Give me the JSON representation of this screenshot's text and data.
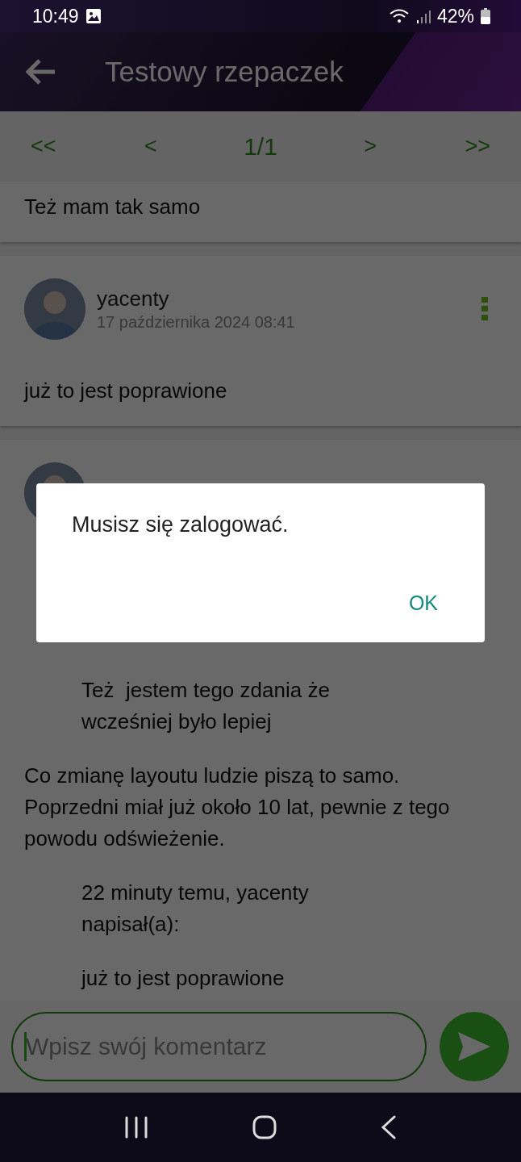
{
  "status_bar": {
    "time": "10:49",
    "battery": "42%"
  },
  "app_bar": {
    "title": "Testowy rzepaczek"
  },
  "pager": {
    "first": "<<",
    "prev": "<",
    "page": "1/1",
    "next": ">",
    "last": ">>"
  },
  "comments": [
    {
      "header": false,
      "blocks": [
        {
          "kind": "text",
          "text": "Też mam tak samo"
        }
      ]
    },
    {
      "header": true,
      "author": "yacenty",
      "date": "17 października 2024 08:41",
      "blocks": [
        {
          "kind": "text",
          "text": "już to jest poprawione"
        }
      ]
    },
    {
      "header": true,
      "blocks": [
        {
          "kind": "quote",
          "text": "Też  jestem tego zdania że wcześniej było lepiej"
        },
        {
          "kind": "text",
          "text": "Co zmianę layoutu ludzie piszą to samo. Poprzedni miał już około 10 lat, pewnie z tego powodu odświeżenie."
        },
        {
          "kind": "quote",
          "text": "22 minuty temu, yacenty napisał(a):"
        },
        {
          "kind": "quote",
          "text": "już to jest poprawione"
        }
      ]
    }
  ],
  "composer": {
    "placeholder": "Wpisz swój komentarz"
  },
  "dialog": {
    "message": "Musisz się zalogować.",
    "button": "OK"
  }
}
